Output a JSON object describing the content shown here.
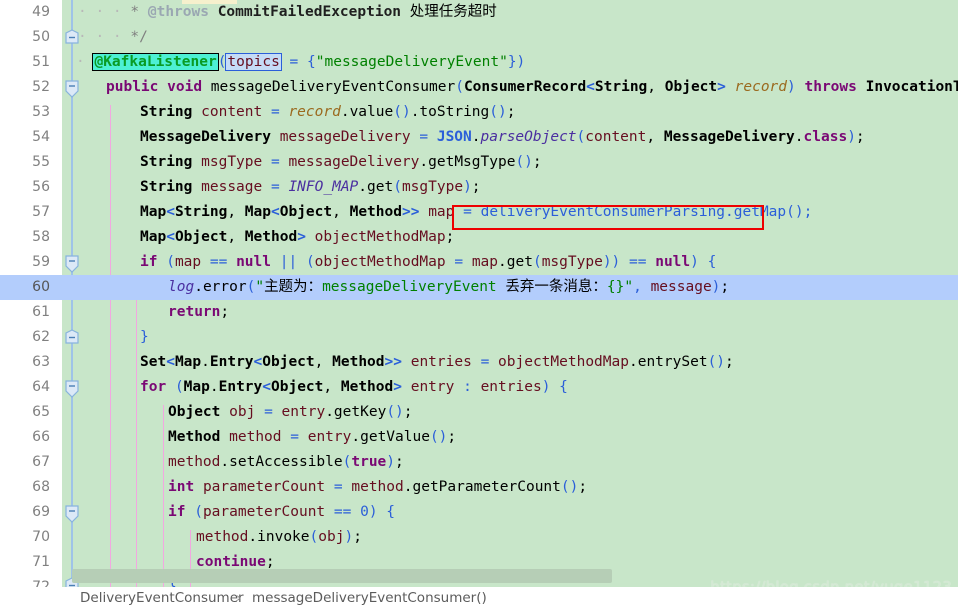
{
  "editor": {
    "first_line": 49,
    "current_line": 60,
    "colors": {
      "code_background": "#c8e6c9",
      "current_line": "#b3cdfc",
      "gutter_background": "#ffffff",
      "line_number": "#808080",
      "callout_box": "#ee0000",
      "annotation_highlight": "#4df0d4",
      "identifier_highlight": "#c5dcf7",
      "indent_guide": "#f2a7e0",
      "fold_line": "#9fc3e8",
      "scrollbar_thumb": "#b6ceb6"
    },
    "lines": [
      {
        "n": 49,
        "text": "     * @throws CommitFailedException 处理任务超时",
        "fold": "none"
      },
      {
        "n": 50,
        "text": "     */",
        "fold": "end"
      },
      {
        "n": 51,
        "text": "    @KafkaListener(topics = {\"messageDeliveryEvent\"})",
        "fold": "none"
      },
      {
        "n": 52,
        "text": "    public void messageDeliveryEventConsumer(ConsumerRecord<String, Object> record) throws InvocationTargetExc",
        "fold": "start"
      },
      {
        "n": 53,
        "text": "        String content = record.value().toString();",
        "fold": "none"
      },
      {
        "n": 54,
        "text": "        MessageDelivery messageDelivery = JSON.parseObject(content, MessageDelivery.class);",
        "fold": "none"
      },
      {
        "n": 55,
        "text": "        String msgType = messageDelivery.getMsgType();",
        "fold": "none"
      },
      {
        "n": 56,
        "text": "        String message = INFO_MAP.get(msgType);",
        "fold": "none"
      },
      {
        "n": 57,
        "text": "        Map<String, Map<Object, Method>> map = deliveryEventConsumerParsing.getMap();",
        "fold": "none"
      },
      {
        "n": 58,
        "text": "        Map<Object, Method> objectMethodMap;",
        "fold": "none"
      },
      {
        "n": 59,
        "text": "        if (map == null || (objectMethodMap = map.get(msgType)) == null) {",
        "fold": "start"
      },
      {
        "n": 60,
        "text": "            log.error(\"主题为：messageDeliveryEvent 丢弃一条消息：{}\", message);",
        "fold": "none"
      },
      {
        "n": 61,
        "text": "            return;",
        "fold": "none"
      },
      {
        "n": 62,
        "text": "        }",
        "fold": "end"
      },
      {
        "n": 63,
        "text": "        Set<Map.Entry<Object, Method>> entries = objectMethodMap.entrySet();",
        "fold": "none"
      },
      {
        "n": 64,
        "text": "        for (Map.Entry<Object, Method> entry : entries) {",
        "fold": "start"
      },
      {
        "n": 65,
        "text": "            Object obj = entry.getKey();",
        "fold": "none"
      },
      {
        "n": 66,
        "text": "            Method method = entry.getValue();",
        "fold": "none"
      },
      {
        "n": 67,
        "text": "            method.setAccessible(true);",
        "fold": "none"
      },
      {
        "n": 68,
        "text": "            int parameterCount = method.getParameterCount();",
        "fold": "none"
      },
      {
        "n": 69,
        "text": "            if (parameterCount == 0) {",
        "fold": "start"
      },
      {
        "n": 70,
        "text": "                method.invoke(obj);",
        "fold": "none"
      },
      {
        "n": 71,
        "text": "                continue;",
        "fold": "none"
      },
      {
        "n": 72,
        "text": "            }",
        "fold": "end"
      }
    ],
    "callout": {
      "label": "deliveryEventConsumerParsing.getMap();",
      "on_line": 57
    },
    "highlighted_tokens": [
      {
        "token": "@KafkaListener",
        "style": "annotation-highlight",
        "on_line": 51
      },
      {
        "token": "topics",
        "style": "identifier-highlight",
        "on_line": 51
      }
    ]
  },
  "breadcrumb": {
    "class_name": "DeliveryEventConsumer",
    "separator": "›",
    "method_name": "messageDeliveryEventConsumer()"
  },
  "watermark": {
    "text": "https://blog.csdn.net/yuge1123"
  }
}
